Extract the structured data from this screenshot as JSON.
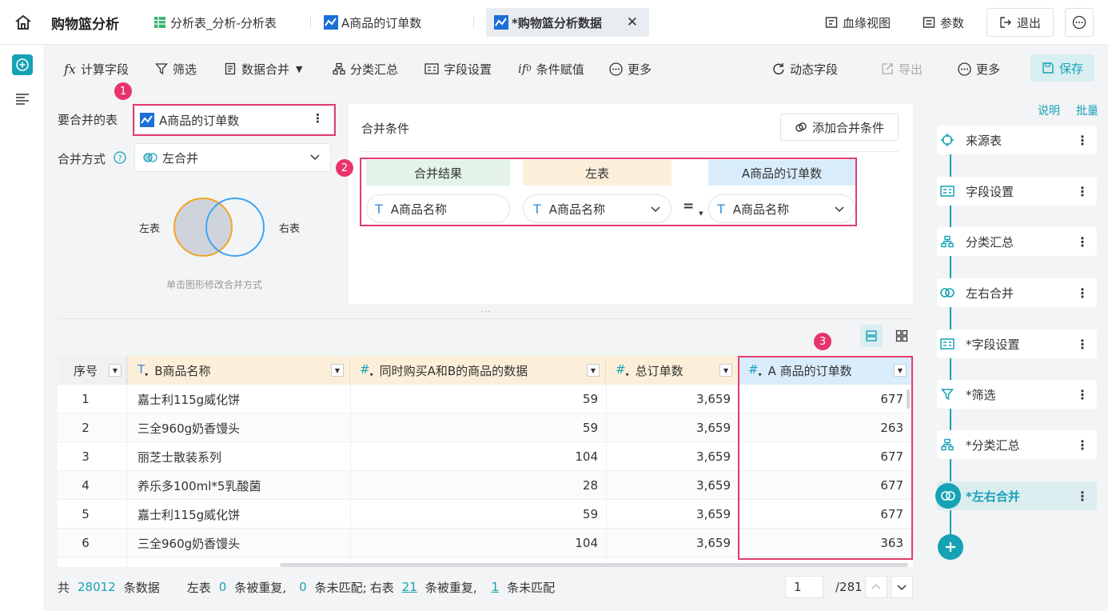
{
  "header": {
    "app_title": "购物篮分析",
    "tabs": [
      {
        "label": "分析表_分析-分析表"
      },
      {
        "label": "A商品的订单数"
      },
      {
        "label": "*购物篮分析数据"
      }
    ],
    "lineage_label": "血缘视图",
    "params_label": "参数",
    "exit_label": "退出"
  },
  "toolbar": {
    "calc_field": "计算字段",
    "filter": "筛选",
    "merge": "数据合并",
    "group_summary": "分类汇总",
    "field_settings": "字段设置",
    "cond_assign": "条件赋值",
    "more_left": "更多",
    "dynamic_field": "动态字段",
    "export": "导出",
    "more_right": "更多",
    "save": "保存"
  },
  "merge_config": {
    "table_label": "要合并的表",
    "table_value": "A商品的订单数",
    "method_label": "合并方式",
    "method_value": "左合并",
    "venn_left": "左表",
    "venn_right": "右表",
    "venn_hint": "单击图形修改合并方式",
    "conditions_title": "合并条件",
    "add_condition": "添加合并条件",
    "col_result": "合并结果",
    "col_left": "左表",
    "col_right": "A商品的订单数",
    "result_field": "A商品名称",
    "left_field": "A商品名称",
    "operator": "=",
    "right_field": "A商品名称",
    "split_dots": "..."
  },
  "badges": {
    "b1": "1",
    "b2": "2",
    "b3": "3"
  },
  "table": {
    "headers": [
      "序号",
      "B商品名称",
      "同时购买A和B的商品的数据",
      "总订单数",
      "A 商品的订单数"
    ],
    "rows": [
      [
        "1",
        "嘉士利115g威化饼",
        "59",
        "3,659",
        "677"
      ],
      [
        "2",
        "三全960g奶香馒头",
        "59",
        "3,659",
        "263"
      ],
      [
        "3",
        "丽芝士散装系列",
        "104",
        "3,659",
        "677"
      ],
      [
        "4",
        "养乐多100ml*5乳酸菌",
        "28",
        "3,659",
        "677"
      ],
      [
        "5",
        "嘉士利115g威化饼",
        "59",
        "3,659",
        "677"
      ],
      [
        "6",
        "三全960g奶香馒头",
        "104",
        "3,659",
        "363"
      ]
    ]
  },
  "footer": {
    "total_prefix": "共",
    "total_count": "28012",
    "total_suffix": "条数据",
    "left_label": "左表",
    "left_dup": "0",
    "dup_text": "条被重复,",
    "left_unmatched": "0",
    "unmatched_text": "条未匹配;",
    "right_label": "右表",
    "right_dup": "21",
    "dup_text2": "条被重复,",
    "right_unmatched": "1",
    "unmatched_text2": "条未匹配",
    "page_current": "1",
    "page_total": "/281"
  },
  "side": {
    "help": "说明",
    "batch": "批量",
    "steps": [
      {
        "label": "来源表"
      },
      {
        "label": "字段设置"
      },
      {
        "label": "分类汇总"
      },
      {
        "label": "左右合并"
      },
      {
        "label": "*字段设置"
      },
      {
        "label": "*筛选"
      },
      {
        "label": "*分类汇总"
      },
      {
        "label": "*左右合并"
      }
    ]
  },
  "colors": {
    "accent": "#16a2b5",
    "highlight_red": "#e33d6d",
    "header_left": "#fcefd9",
    "header_right": "#d8ecfb",
    "venn_left": "#f3a523",
    "venn_right": "#3fa5ef"
  }
}
